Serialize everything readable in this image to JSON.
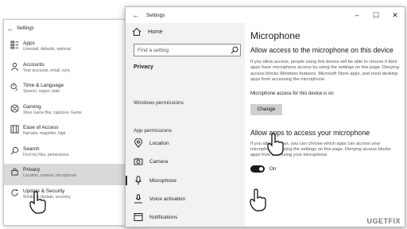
{
  "back_window": {
    "title": "Settings",
    "items": [
      {
        "label": "Apps",
        "sub": "Uninstall, defaults, optional"
      },
      {
        "label": "Accounts",
        "sub": "Your accounts, email, sync"
      },
      {
        "label": "Time & Language",
        "sub": "Speech, region, date"
      },
      {
        "label": "Gaming",
        "sub": "Xbox Game Bar, captures, Game"
      },
      {
        "label": "Ease of Access",
        "sub": "Narrator, magnifier, high"
      },
      {
        "label": "Search",
        "sub": "Find my files, permissions"
      },
      {
        "label": "Privacy",
        "sub": "Location, camera, microphone"
      },
      {
        "label": "Update & Security",
        "sub": "Windows Update, recovery"
      }
    ]
  },
  "front_window": {
    "title": "Settings",
    "controls": {
      "minimize": "–",
      "maximize": "☐",
      "close": "✕"
    },
    "sidebar": {
      "home": "Home",
      "search_placeholder": "Find a setting",
      "section": "Privacy",
      "windows_permissions": "Windows permissions",
      "app_permissions": "App permissions",
      "items": [
        "Location",
        "Camera",
        "Microphone",
        "Voice activation",
        "Notifications"
      ]
    },
    "main": {
      "title": "Microphone",
      "h_allow_device": "Allow access to the microphone on this device",
      "p_allow_device": "If you allow access, people using this device will be able to choose if their apps have microphone access by using the settings on this page. Denying access blocks Windows features, Microsoft Store apps, and most desktop apps from accessing the microphone.",
      "device_status": "Microphone access for this device is on",
      "change_button": "Change",
      "h_allow_apps": "Allow apps to access your microphone",
      "p_allow_apps": "If you allow access, you can choose which apps can access your microphone by using the settings on this page. Denying access blocks apps from accessing your microphone.",
      "toggle_state": "On"
    }
  },
  "watermark": "UGETFIX",
  "colors": {
    "selection": "#d9d9d9",
    "sidebar_bg": "#f2f2f2",
    "button": "#cfcfcf",
    "toggle": "#1b1b1b"
  }
}
